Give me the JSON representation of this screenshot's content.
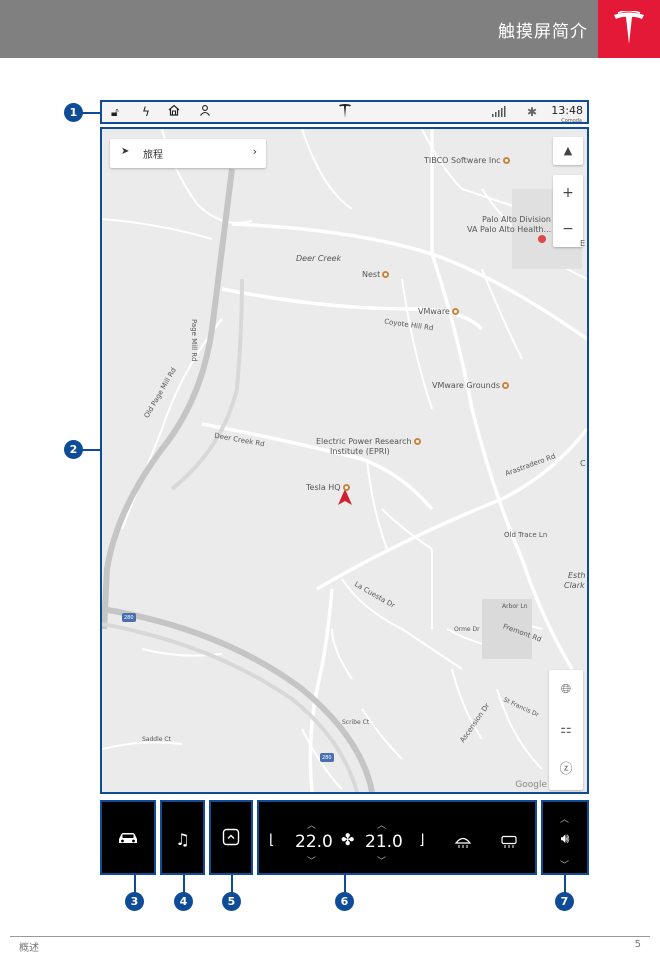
{
  "header": {
    "title": "触摸屏简介"
  },
  "callouts": [
    "1",
    "2",
    "3",
    "4",
    "5",
    "6",
    "7"
  ],
  "status_bar": {
    "time": "13:48",
    "time_sub": "Comoda"
  },
  "map": {
    "nav_label": "旅程",
    "labels": {
      "tibco": "TIBCO Software Inc",
      "palo_alto_division": "Palo Alto Division",
      "va_palo_alto": "VA Palo Alto Health...",
      "deer_creek": "Deer Creek",
      "nest": "Nest",
      "vmware": "VMware",
      "coyote_hill": "Coyote Hill Rd",
      "vmware_grounds": "VMware Grounds",
      "deer_creek_rd": "Deer Creek Rd",
      "epri_1": "Electric Power Research",
      "epri_2": "Institute (EPRI)",
      "tesla_hq": "Tesla HQ",
      "page_mill": "Page Mill Rd",
      "old_page_mill": "Old Page Mill Rd",
      "arastradero": "Arastradero Rd",
      "old_trace": "Old Trace Ln",
      "clark_1": "Esth",
      "clark_2": "Clark",
      "la_cuesta": "La Cuesta Dr",
      "orme": "Orme Dr",
      "fremont": "Fremont Rd",
      "arbor": "Arbor Ln",
      "ascension": "Ascension Dr",
      "st_francis": "St Francis Dr",
      "scribe": "Scribe Ct",
      "saddle": "Saddle Ct",
      "hwy280": "280",
      "hwy280b": "280",
      "e": "E",
      "c": "C",
      "google": "Google"
    }
  },
  "climate": {
    "driver_temp": "22.0",
    "passenger_temp": "21.0"
  },
  "footer": {
    "left": "概述",
    "right": "5"
  }
}
